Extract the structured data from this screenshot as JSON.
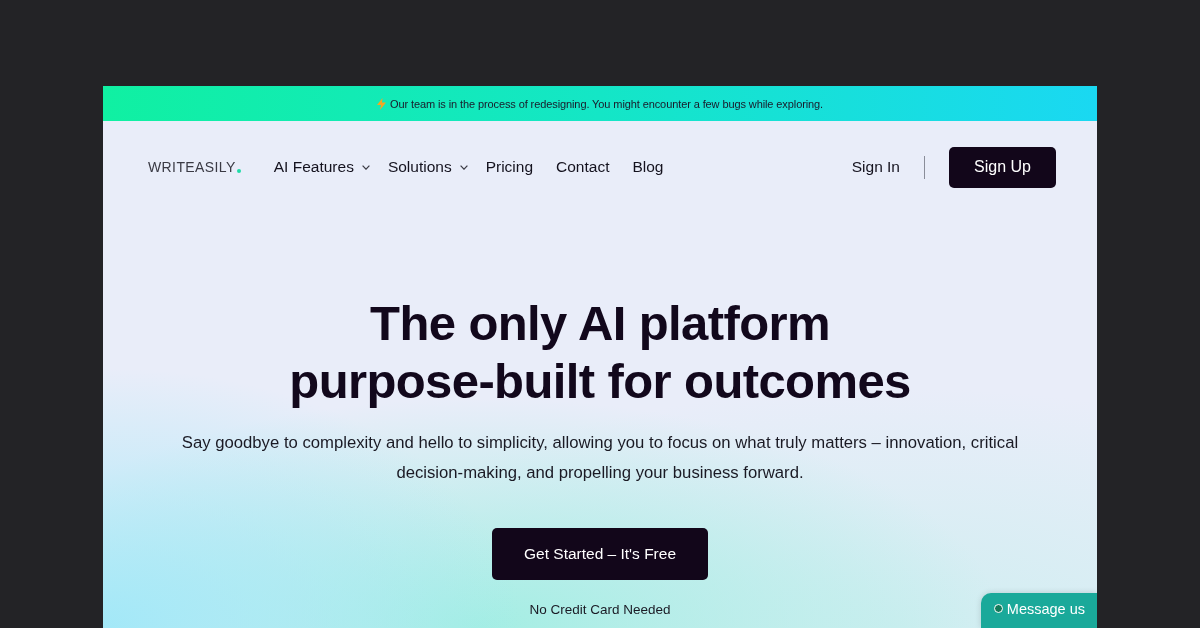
{
  "banner": {
    "text": "Our team is in the process of redesigning. You might encounter a few bugs while exploring."
  },
  "nav": {
    "logo": "WRITEASILY",
    "items": [
      {
        "label": "AI Features",
        "dropdown": true
      },
      {
        "label": "Solutions",
        "dropdown": true
      },
      {
        "label": "Pricing",
        "dropdown": false
      },
      {
        "label": "Contact",
        "dropdown": false
      },
      {
        "label": "Blog",
        "dropdown": false
      }
    ],
    "sign_in": "Sign In",
    "sign_up": "Sign Up"
  },
  "hero": {
    "title": "The only AI platform purpose-built for outcomes",
    "subtitle": "Say goodbye to complexity and hello to simplicity, allowing you to focus on what truly matters – innovation, critical decision-making, and propelling your business forward.",
    "cta": "Get Started – It's Free",
    "note": "No Credit Card Needed"
  },
  "chat_button": {
    "label": "Message us"
  }
}
